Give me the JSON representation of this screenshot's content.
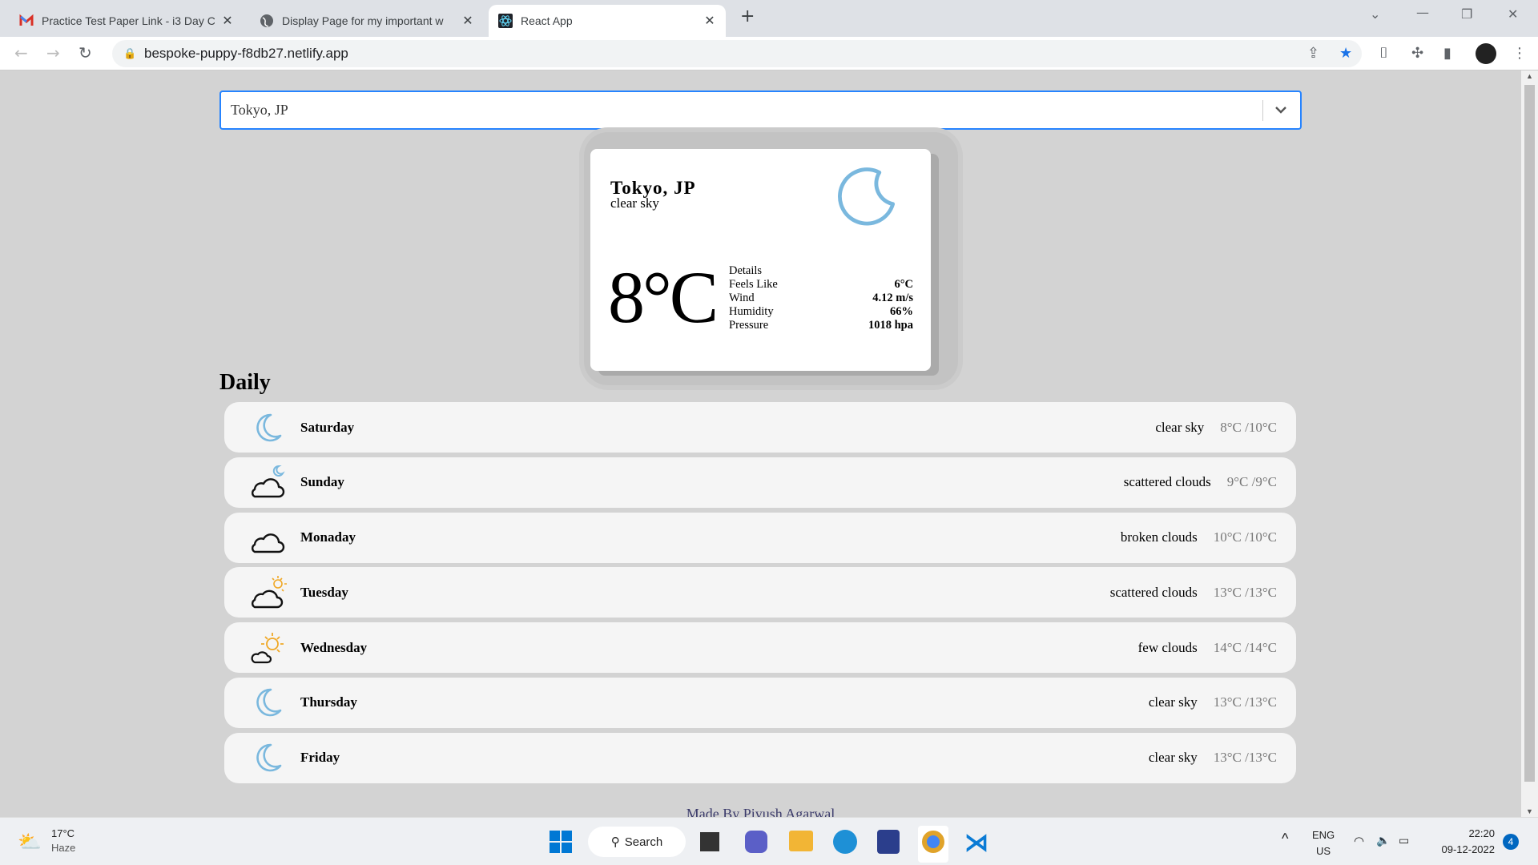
{
  "browser": {
    "tabs": [
      {
        "title": "Practice Test Paper Link - i3 Day C",
        "icon": "gmail-icon"
      },
      {
        "title": "Display Page for my important w",
        "icon": "globe-icon"
      },
      {
        "title": "React App",
        "icon": "react-icon",
        "active": true
      }
    ],
    "url": "bespoke-puppy-f8db27.netlify.app"
  },
  "search": {
    "selected": "Tokyo, JP"
  },
  "current": {
    "city": "Tokyo, JP",
    "description": "clear sky",
    "temperature": "8°C",
    "details_label": "Details",
    "details": [
      {
        "label": "Feels Like",
        "value": "6°C"
      },
      {
        "label": "Wind",
        "value": "4.12 m/s"
      },
      {
        "label": "Humidity",
        "value": "66%"
      },
      {
        "label": "Pressure",
        "value": "1018 hpa"
      }
    ],
    "icon": "moon-icon"
  },
  "daily": {
    "title": "Daily",
    "items": [
      {
        "day": "Saturday",
        "description": "clear sky",
        "minmax": "8°C /10°C",
        "icon": "moon"
      },
      {
        "day": "Sunday",
        "description": "scattered clouds",
        "minmax": "9°C /9°C",
        "icon": "cloud-moon"
      },
      {
        "day": "Monaday",
        "description": "broken clouds",
        "minmax": "10°C /10°C",
        "icon": "cloud"
      },
      {
        "day": "Tuesday",
        "description": "scattered clouds",
        "minmax": "13°C /13°C",
        "icon": "cloud-sun"
      },
      {
        "day": "Wednesday",
        "description": "few clouds",
        "minmax": "14°C /14°C",
        "icon": "sun-cloud"
      },
      {
        "day": "Thursday",
        "description": "clear sky",
        "minmax": "13°C /13°C",
        "icon": "moon"
      },
      {
        "day": "Friday",
        "description": "clear sky",
        "minmax": "13°C /13°C",
        "icon": "moon"
      }
    ]
  },
  "footer": "Made By Piyush Agarwal",
  "taskbar": {
    "weather_temp": "17°C",
    "weather_desc": "Haze",
    "search_label": "Search",
    "lang": "ENG",
    "region": "US",
    "time": "22:20",
    "date": "09-12-2022",
    "notifications": "4"
  },
  "colors": {
    "moon": "#7ab8de",
    "sun": "#f0a826",
    "accent": "#2684ff"
  }
}
